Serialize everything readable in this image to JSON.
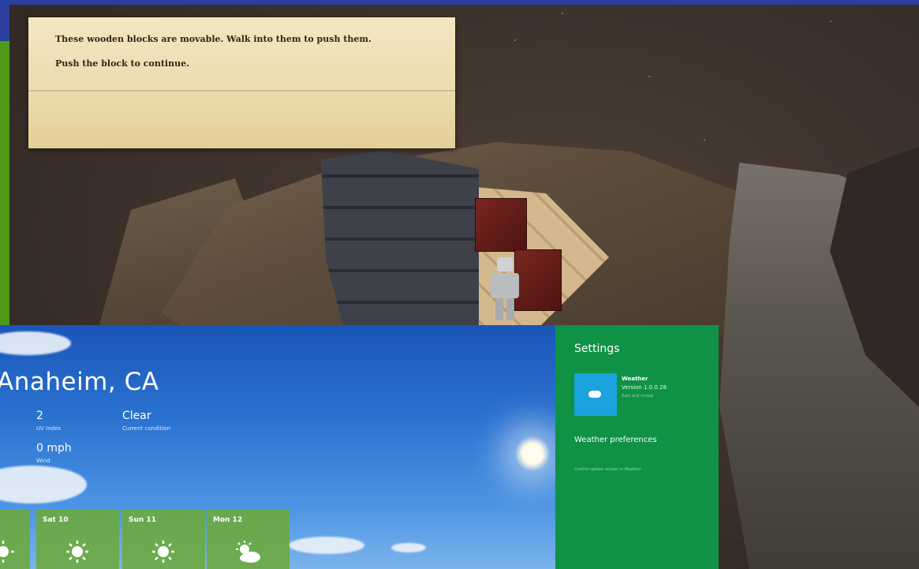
{
  "game": {
    "dialog_line1": "These wooden blocks are movable. Walk into them to push them.",
    "dialog_line2": "Push the block to continue."
  },
  "weather": {
    "city": "Anaheim, CA",
    "uv_value": "2",
    "uv_label": "UV Index",
    "condition_value": "Clear",
    "condition_label": "Current condition",
    "wind_value": "0 mph",
    "wind_label": "Wind",
    "forecast": [
      {
        "day": "Sat 10",
        "icon": "sun-icon"
      },
      {
        "day": "Sun 11",
        "icon": "sun-icon"
      },
      {
        "day": "Mon 12",
        "icon": "partly-cloudy-icon"
      }
    ]
  },
  "settings": {
    "title": "Settings",
    "app_name": "Weather",
    "app_version": "Version 1.0.0.28",
    "app_sub": "Rate and review",
    "preferences_label": "Weather preferences",
    "preferences_sub": "Control update access in Weather"
  },
  "colors": {
    "frame_blue": "#2b3f9f",
    "accent_green": "#4c9a17",
    "settings_green": "#0f9246",
    "tile_blue": "#1aa3dc"
  }
}
